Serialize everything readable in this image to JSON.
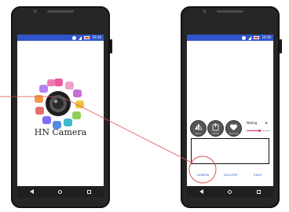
{
  "status": {
    "time": "10:36"
  },
  "splash": {
    "title": "HN Camera"
  },
  "editor": {
    "buttons": [
      {
        "name": "mirror",
        "label": "Mirror",
        "icon": "mirror-icon"
      },
      {
        "name": "rotate",
        "label": "Rotate",
        "icon": "rotate-icon"
      },
      {
        "name": "favourite",
        "label": "Favourite",
        "icon": "heart-icon"
      }
    ],
    "effect": {
      "selected": "Noting",
      "slider_level": 0.55
    },
    "tabs": {
      "camera": "CAMERA",
      "gallery": "GALLERY",
      "save": "SAVE"
    }
  },
  "colors": {
    "statusbar": "#2f55c9",
    "accent": "#e0226f",
    "annotation": "#d9534f",
    "tab_text": "#2f55c9"
  }
}
